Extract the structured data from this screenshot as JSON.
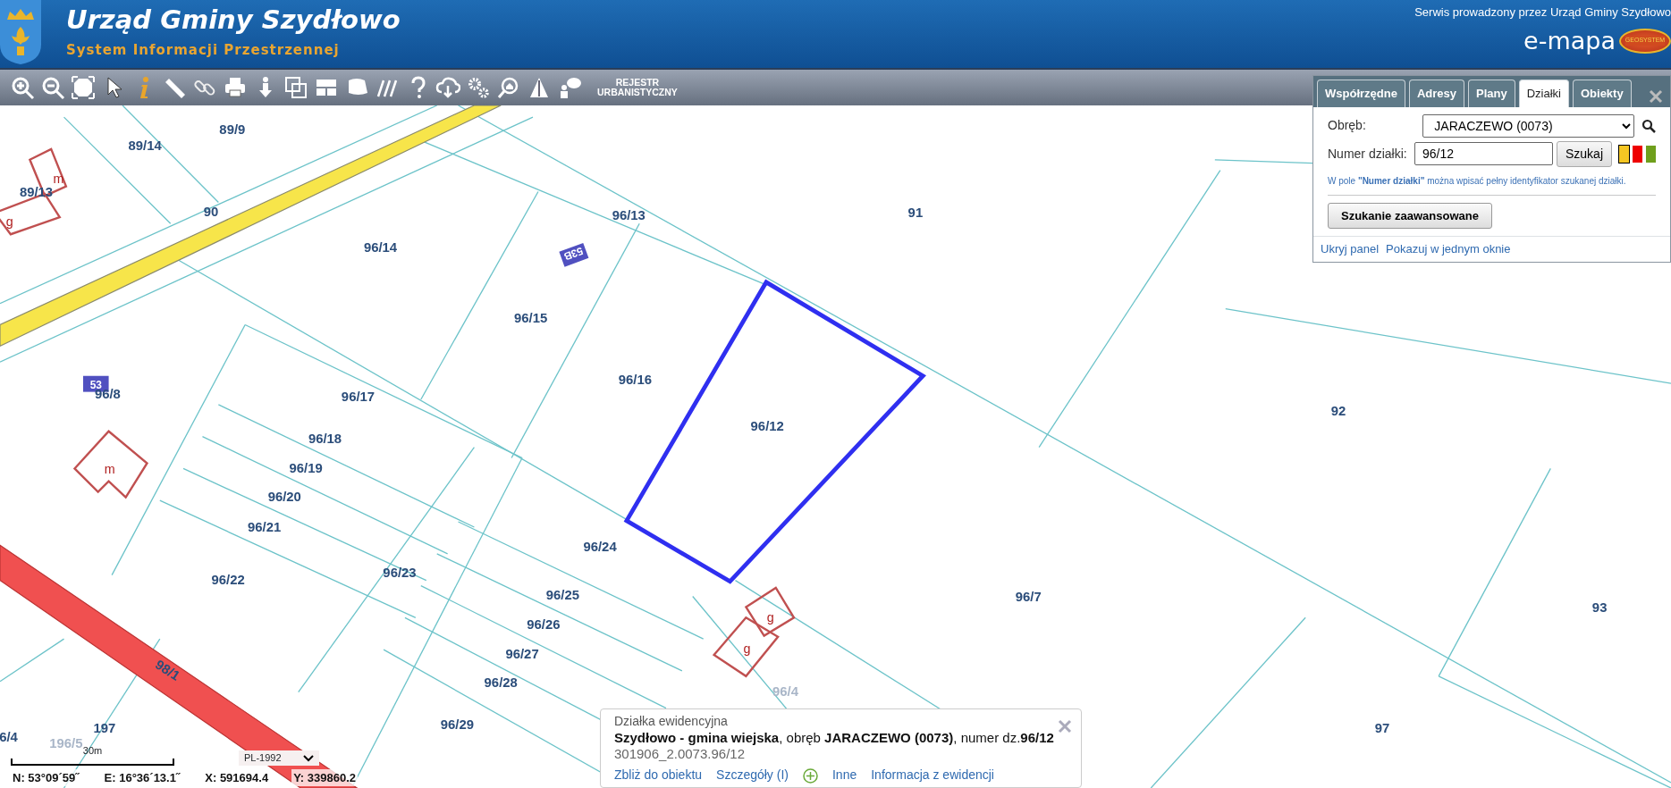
{
  "header": {
    "title": "Urząd Gminy Szydłowo",
    "subtitle": "System Informacji Przestrzennej",
    "service_note": "Serwis prowadzony przez Urząd Gminy Szydłowo",
    "brand": "e-mapa",
    "brand_badge": "GEOSYSTEM"
  },
  "toolbar": {
    "register_button": "REJESTR URBANISTYCZNY"
  },
  "map": {
    "parcel_labels": [
      {
        "text": "89/9",
        "faded": false
      },
      {
        "text": "89/14",
        "faded": false
      },
      {
        "text": "89/13",
        "faded": false
      },
      {
        "text": "90",
        "faded": false
      },
      {
        "text": "96/14",
        "faded": false
      },
      {
        "text": "96/13",
        "faded": false
      },
      {
        "text": "91",
        "faded": false
      },
      {
        "text": "96/15",
        "faded": false
      },
      {
        "text": "96/16",
        "faded": false
      },
      {
        "text": "96/8",
        "faded": false
      },
      {
        "text": "96/17",
        "faded": false
      },
      {
        "text": "96/18",
        "faded": false
      },
      {
        "text": "96/19",
        "faded": false
      },
      {
        "text": "96/20",
        "faded": false
      },
      {
        "text": "96/21",
        "faded": false
      },
      {
        "text": "96/12",
        "faded": false
      },
      {
        "text": "92",
        "faded": false
      },
      {
        "text": "96/24",
        "faded": false
      },
      {
        "text": "96/22",
        "faded": false
      },
      {
        "text": "96/23",
        "faded": false
      },
      {
        "text": "96/25",
        "faded": false
      },
      {
        "text": "96/26",
        "faded": false
      },
      {
        "text": "96/27",
        "faded": false
      },
      {
        "text": "96/28",
        "faded": false
      },
      {
        "text": "96/7",
        "faded": false
      },
      {
        "text": "93",
        "faded": false
      },
      {
        "text": "98/1",
        "faded": false
      },
      {
        "text": "197",
        "faded": false
      },
      {
        "text": "96/29",
        "faded": false
      },
      {
        "text": "96/4",
        "faded": true
      },
      {
        "text": "97",
        "faded": false
      },
      {
        "text": "6/4",
        "faded": false
      },
      {
        "text": "196/5",
        "faded": true
      }
    ],
    "building_labels": [
      "m",
      "g",
      "m",
      "g",
      "g"
    ],
    "address_labels": [
      "53B",
      "53"
    ]
  },
  "search_panel": {
    "tabs": [
      {
        "label": "Współrzędne",
        "selected": false
      },
      {
        "label": "Adresy",
        "selected": false
      },
      {
        "label": "Plany",
        "selected": false
      },
      {
        "label": "Działki",
        "selected": true
      },
      {
        "label": "Obiekty",
        "selected": false
      }
    ],
    "fields": [
      {
        "label": "Obręb:",
        "value": "JARACZEWO (0073)",
        "kind": "select"
      },
      {
        "label": "Numer działki:",
        "value": "96/12",
        "kind": "input"
      }
    ],
    "search_button": "Szukaj",
    "color_swatches": [
      {
        "color": "#f5c623",
        "selected": true
      },
      {
        "color": "#ee0000",
        "selected": false
      },
      {
        "color": "#6f9f1c",
        "selected": false
      }
    ],
    "hint": "W pole **\"Numer działki\"** można wpisać pełny identyfikator szukanej działki.",
    "advanced_button": "Szukanie zaawansowane",
    "links": [
      "Ukryj panel",
      "Pokazuj w jednym oknie"
    ]
  },
  "info_popup": {
    "heading": "Działka ewidencyjna",
    "description": "**Szydłowo - gmina wiejska**, obręb **JARACZEWO (0073)**, numer dz.**96/12**",
    "identifier": "301906_2.0073.96/12",
    "links": [
      "Zbliż do obiektu",
      "Szczegóły (I)",
      "Inne",
      "Informacja z ewidencji"
    ]
  },
  "status": {
    "scale_label": "30m",
    "projection": "PL-1992",
    "coordinates": [
      "N: 53°09´59˝",
      "E: 16°36´13.1˝",
      "X: 591694.4",
      "Y: 339860.2"
    ]
  }
}
